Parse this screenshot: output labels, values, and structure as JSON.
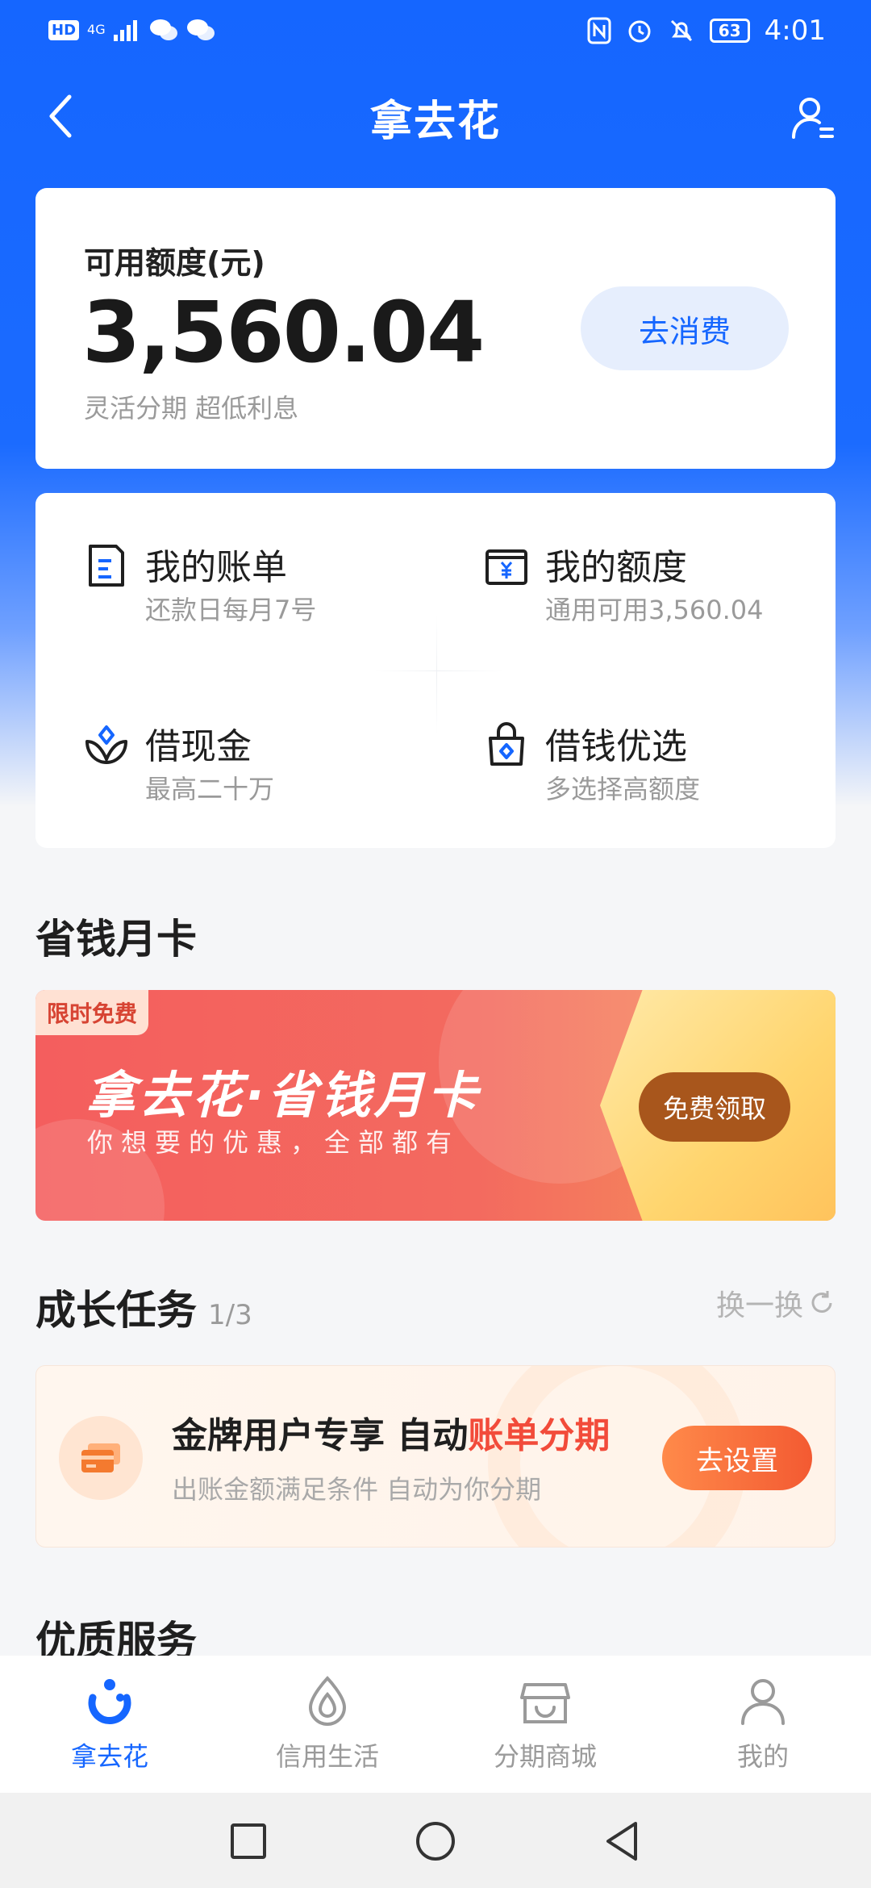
{
  "status_bar": {
    "network_badge": "HD",
    "signal_label": "4G",
    "battery": "63",
    "time": "4:01"
  },
  "nav": {
    "title": "拿去花"
  },
  "credit": {
    "label": "可用额度(元)",
    "amount": "3,560.04",
    "subtitle": "灵活分期 超低利息",
    "button": "去消费"
  },
  "grid": [
    {
      "title": "我的账单",
      "sub": "还款日每月7号",
      "icon": "bill-icon"
    },
    {
      "title": "我的额度",
      "sub": "通用可用3,560.04",
      "icon": "quota-icon"
    },
    {
      "title": "借现金",
      "sub": "最高二十万",
      "icon": "cash-loan-icon"
    },
    {
      "title": "借钱优选",
      "sub": "多选择高额度",
      "icon": "loan-select-icon"
    }
  ],
  "monthly_card": {
    "section_title": "省钱月卡",
    "tag": "限时免费",
    "title": "拿去花·省钱月卡",
    "subtitle": "你想要的优惠，全部都有",
    "button": "免费领取"
  },
  "tasks": {
    "section_title": "成长任务",
    "count": "1/3",
    "refresh": "换一换",
    "card": {
      "title_prefix": "金牌用户专享 自动",
      "title_highlight": "账单分期",
      "subtitle": "出账金额满足条件 自动为你分期",
      "button": "去设置"
    }
  },
  "services": {
    "section_title": "优质服务"
  },
  "tabbar": [
    {
      "label": "拿去花",
      "icon": "nqh-logo-icon",
      "active": true
    },
    {
      "label": "信用生活",
      "icon": "credit-life-icon",
      "active": false
    },
    {
      "label": "分期商城",
      "icon": "mall-icon",
      "active": false
    },
    {
      "label": "我的",
      "icon": "profile-icon",
      "active": false
    }
  ],
  "colors": {
    "brand_blue": "#1566ff",
    "highlight_red": "#f24b3a",
    "banner_red": "#f45e5e",
    "button_orange": "#f35a32"
  }
}
